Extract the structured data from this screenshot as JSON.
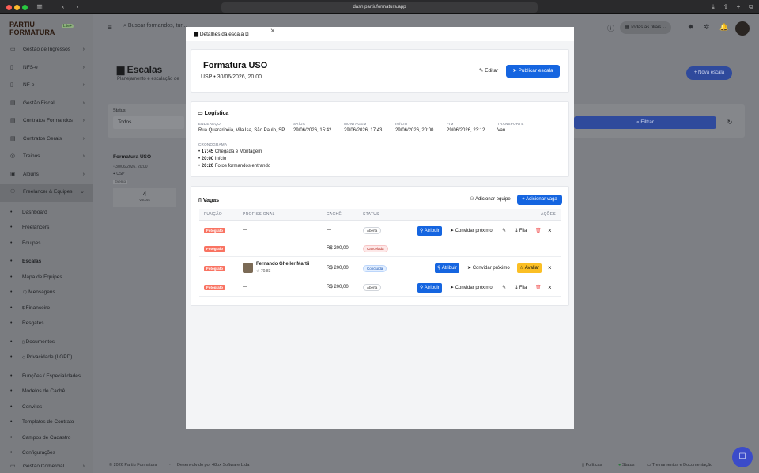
{
  "browser": {
    "url": "dash.partiuformatura.app"
  },
  "colors": {
    "accent": "#1565e0",
    "danger": "#ef4444",
    "warning": "#fbbf24",
    "badge": "#f97362"
  },
  "sidebar": {
    "logo_line1": "PARTIU",
    "logo_line2": "FORMATURA",
    "logo_badge": "Lite+",
    "items": [
      {
        "label": "Gestão de Ingressos",
        "icon": "ticket-icon"
      },
      {
        "label": "NFS-e",
        "icon": "file-icon"
      },
      {
        "label": "NF-e",
        "icon": "file-icon"
      },
      {
        "label": "Gestão Fiscal",
        "icon": "receipt-icon"
      },
      {
        "label": "Contratos Formandos",
        "icon": "contract-icon"
      },
      {
        "label": "Contratos Gerais",
        "icon": "contract-icon"
      },
      {
        "label": "Treinos",
        "icon": "target-icon"
      },
      {
        "label": "Álbuns",
        "icon": "album-icon"
      },
      {
        "label": "Freelancer & Equipes",
        "icon": "users-icon"
      }
    ],
    "sub_items": [
      {
        "label": "Dashboard"
      },
      {
        "label": "Freelancers"
      },
      {
        "label": "Equipes"
      },
      {
        "label": "Escalas"
      },
      {
        "label": "Mapa de Equipes"
      },
      {
        "label": "Mensagens"
      },
      {
        "label": "Financeiro"
      },
      {
        "label": "Resgates"
      },
      {
        "label": "Documentos"
      },
      {
        "label": "Privacidade (LGPD)"
      },
      {
        "label": "Funções / Especialidades"
      },
      {
        "label": "Modelos de Cachê"
      },
      {
        "label": "Convites"
      },
      {
        "label": "Templates de Contrato"
      },
      {
        "label": "Campos de Cadastro"
      },
      {
        "label": "Configurações"
      }
    ],
    "bottom_item": {
      "label": "Gestão Comercial"
    }
  },
  "topbar": {
    "search_placeholder": "Buscar formandos, tur...",
    "branch_filter": "Todas as filiais"
  },
  "page": {
    "title": "Escalas",
    "subtitle": "Planejamento e escalação de",
    "new_button": "+ Nova escala",
    "status_label": "Status",
    "status_value": "Todos",
    "filter_button": "Filtrar",
    "event_card": {
      "title": "Formatura USO",
      "date": "30/06/2026, 20:00",
      "location": "USP",
      "tag": "Evento",
      "count": "4",
      "count_label": "VAGAS"
    }
  },
  "footer": {
    "copyright": "© 2026 Partiu Formatura",
    "dev": "Desenvolvido por 48px Software Ltda",
    "policies": "Políticas",
    "status": "Status",
    "training": "Treinamentos e Documentação"
  },
  "modal": {
    "header_title": "Detalhes da escala",
    "event_title": "Formatura USO",
    "event_subtitle": "USP • 30/06/2026, 20:00",
    "edit_button": "Editar",
    "publish_button": "Publicar escala",
    "logistics": {
      "title": "Logística",
      "address_label": "ENDEREÇO",
      "address": "Rua Quararibéia, Vila Isa, São Paulo, SP",
      "departure_label": "SAÍDA",
      "departure": "29/06/2026, 15:42",
      "setup_label": "MONTAGEM",
      "setup": "29/06/2026, 17:43",
      "start_label": "INÍCIO",
      "start": "29/06/2026, 20:00",
      "end_label": "FIM",
      "end": "29/06/2026, 23:12",
      "transport_label": "TRANSPORTE",
      "transport": "Van",
      "schedule_label": "CRONOGRAMA",
      "schedule": [
        {
          "time": "17:45",
          "text": "Chegada e Montagem"
        },
        {
          "time": "20:00",
          "text": "Início"
        },
        {
          "time": "20:20",
          "text": "Fotos formandos entrando"
        }
      ]
    },
    "vagas": {
      "title": "Vagas",
      "add_team": "Adicionar equipe",
      "add_slot": "+ Adicionar vaga",
      "columns": [
        "FUNÇÃO",
        "PROFISSIONAL",
        "CACHÊ",
        "STATUS",
        "AÇÕES"
      ],
      "rows": [
        {
          "role": "Fotógrafo",
          "professional": "—",
          "fee": "—",
          "status": "Aberta"
        },
        {
          "role": "Fotógrafo",
          "professional": "—",
          "fee": "R$ 200,00",
          "status": "Cancelada"
        },
        {
          "role": "Fotógrafo",
          "professional": "Fernando Gheller Martii",
          "rating": "☆ 70.83",
          "fee": "R$ 200,00",
          "status": "Concluída"
        },
        {
          "role": "Fotógrafo",
          "professional": "—",
          "fee": "R$ 200,00",
          "status": "Aberta"
        }
      ],
      "actions": {
        "assign": "Atribuir",
        "invite": "Convidar próximo",
        "queue": "Fila",
        "rate": "Avaliar"
      }
    }
  }
}
